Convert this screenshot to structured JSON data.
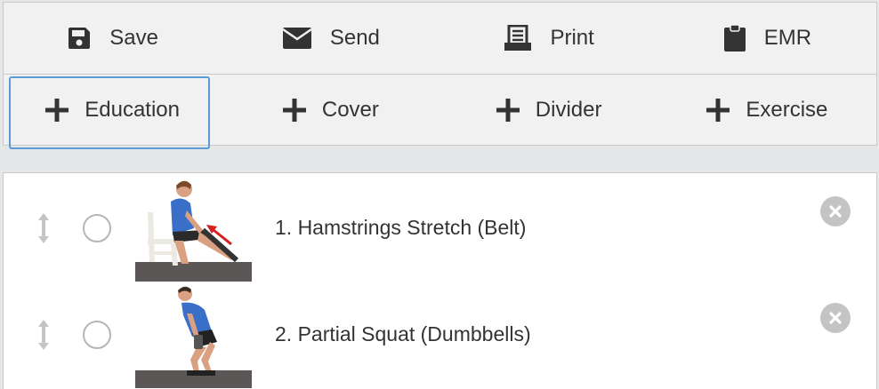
{
  "toolbar": {
    "actions": [
      {
        "label": "Save",
        "icon": "save-icon"
      },
      {
        "label": "Send",
        "icon": "envelope-icon"
      },
      {
        "label": "Print",
        "icon": "print-icon"
      },
      {
        "label": "EMR",
        "icon": "clipboard-icon"
      }
    ],
    "add_buttons": [
      {
        "label": "Education",
        "icon": "plus-icon",
        "selected": true
      },
      {
        "label": "Cover",
        "icon": "plus-icon"
      },
      {
        "label": "Divider",
        "icon": "plus-icon"
      },
      {
        "label": "Exercise",
        "icon": "plus-icon"
      }
    ]
  },
  "exercises": [
    {
      "title": "1.  Hamstrings Stretch (Belt)",
      "thumbnail": "seated-hamstring-stretch-photo"
    },
    {
      "title": "2.  Partial Squat (Dumbbells)",
      "thumbnail": "partial-squat-photo"
    }
  ],
  "colors": {
    "selected_border": "#5c9ad6",
    "toolbar_bg": "#f1f1f1",
    "page_bg": "#e6e7e8",
    "icon_gray": "#c4c4c4"
  }
}
